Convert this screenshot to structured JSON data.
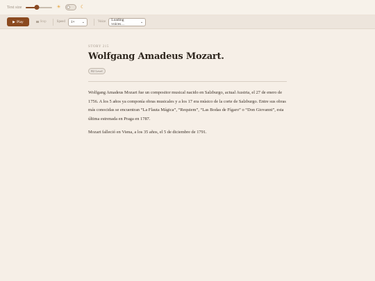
{
  "settings": {
    "text_size_label": "Text size",
    "text_size_value": 0.4,
    "sun_icon": "sun-icon",
    "moon_icon": "moon-icon",
    "dark_mode": false
  },
  "toolbar": {
    "play_label": "Play",
    "stop_label": "Stop",
    "speed_label": "Speed",
    "speed_value": "1×",
    "voice_label": "Voice",
    "voice_value": "Loading voices…"
  },
  "story": {
    "number": "STORY 215",
    "title": "Wolfgang Amadeus Mozart.",
    "level": "B2 Level",
    "paragraphs": [
      "Wolfgang Amadeus Mozart fue un compositor musical nacido en Salzburgo, actual Austria, el 27 de enero de 1756. A los 5 años ya componía obras musicales y a los 17 era músico de la corte de Salzburgo. Entre sus obras más conocidas se encuentran “La Flauta Mágica”, “Requiem”, “Las Bodas de Fígaro” o “Don Giovanni”, esta última estrenada en Praga en 1787.",
      "Mozart falleció en Viena, a los 35 años, el 5 de diciembre de 1791."
    ]
  },
  "colors": {
    "accent": "#8b4a20",
    "background": "#f6efe7",
    "toolbar": "#ede5dc"
  }
}
